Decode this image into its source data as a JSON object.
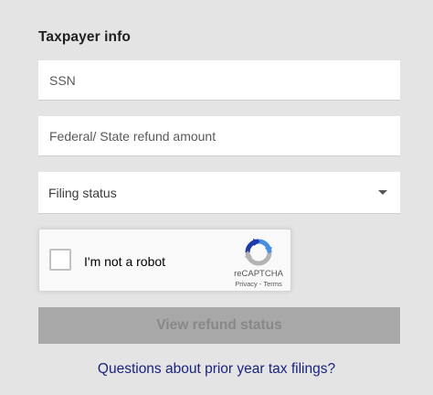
{
  "form": {
    "title": "Taxpayer info",
    "ssn_placeholder": "SSN",
    "refund_placeholder": "Federal/ State refund amount",
    "filing_status_label": "Filing status",
    "submit_label": "View refund status",
    "prior_year_link": "Questions about prior year tax filings?"
  },
  "captcha": {
    "label": "I'm not a robot",
    "brand": "reCAPTCHA",
    "privacy": "Privacy",
    "separator": " - ",
    "terms": "Terms",
    "logo_icon": "recaptcha-logo-icon"
  },
  "colors": {
    "background": "#e4e4e4",
    "submit_disabled": "#a8a8a8",
    "link": "#1a237e",
    "recaptcha_blue": "#4a90e2",
    "recaptcha_dark_blue": "#1c3aa9",
    "recaptcha_gray": "#b3b3b3"
  }
}
